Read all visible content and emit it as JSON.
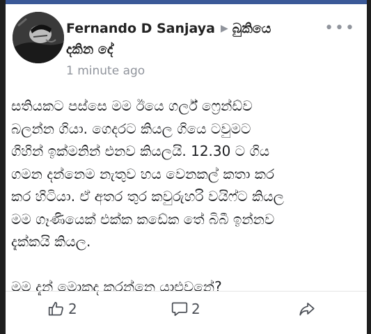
{
  "post": {
    "author": "Fernando D Sanjaya",
    "group_line1": "බුකියෙ",
    "group_line2": "දකින දේ",
    "timestamp": "1 minute ago",
    "more_icon": "more-dots-icon",
    "body_lines": [
      "සතියකට පස්සෙ මම ඊයෙ ගර්ල් ෆ්‍රෙන්ඩ්ව",
      "බලන්න ගියා. ගෙදරට කියල ගියෙ ටවුමට",
      "ගිහින් ඉක්මනින් එනව කියලයි. 12.30 ට ගිය",
      "ගමන දන්නෙම නැතුව හය වෙනකල් කතා කර",
      "කර හිටියා. ඒ අතර තුර කවුරුහරි වයිෆ්ට කියල",
      "මම ගෑණියෙක් එක්ක කඩේක තේ බිබී ඉන්නව",
      "දැක්කයි කියල."
    ],
    "body_question": "මම දැන් මොකද කරන්නෙ යාළුවනේ?"
  },
  "actions": {
    "like_count": "2",
    "comment_count": "2",
    "like_icon": "thumbs-up-icon",
    "comment_icon": "comment-icon",
    "share_icon": "share-icon"
  },
  "colors": {
    "accent": "#3b5998",
    "text": "#1c1e21",
    "muted": "#90949c",
    "frame": "#1f1f1f"
  }
}
